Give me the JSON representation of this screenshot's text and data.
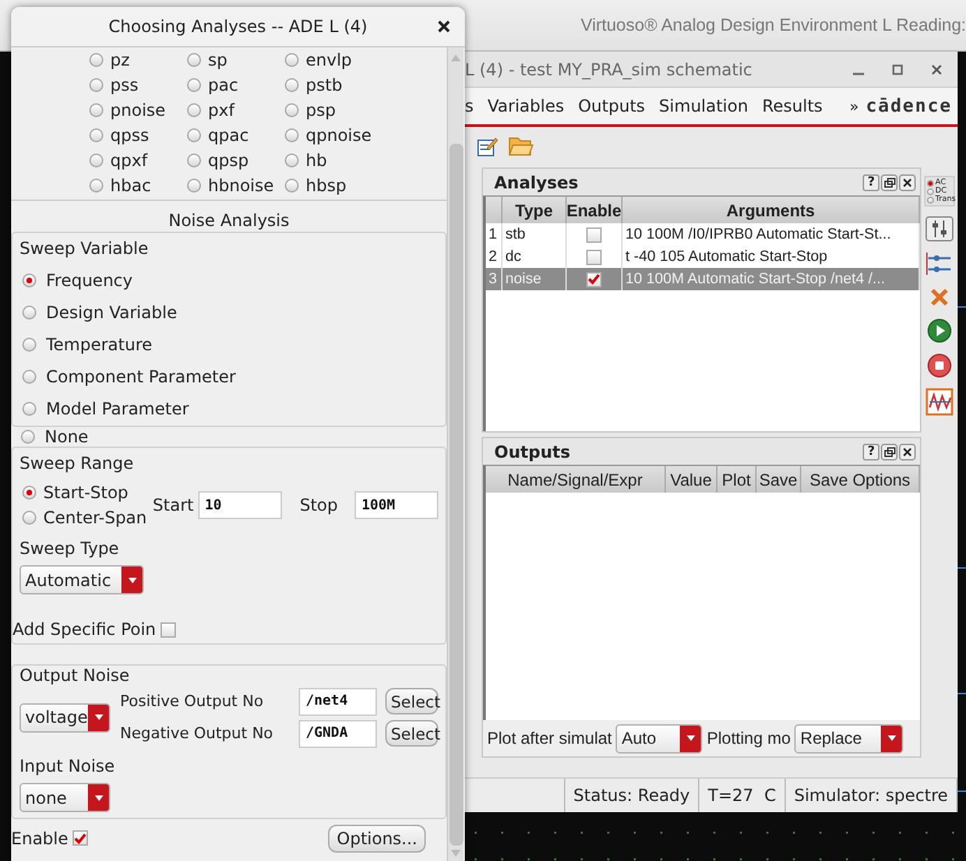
{
  "background_window": {
    "title": "Virtuoso® Analog Design Environment L Reading:"
  },
  "main_window": {
    "title": "L (4) - test MY_PRA_sim schematic",
    "menu": [
      "s",
      "Variables",
      "Outputs",
      "Simulation",
      "Results"
    ],
    "menu_overflow": "»",
    "logo": "cādence",
    "analyses": {
      "title": "Analyses",
      "help": "?",
      "columns": [
        "Type",
        "Enable",
        "Arguments"
      ],
      "rows": [
        {
          "number": "1",
          "type": "stb",
          "enabled": false,
          "arguments": "10 100M /I0/IPRB0 Automatic Start-St...",
          "selected": false
        },
        {
          "number": "2",
          "type": "dc",
          "enabled": false,
          "arguments": "t -40 105 Automatic Start-Stop",
          "selected": false
        },
        {
          "number": "3",
          "type": "noise",
          "enabled": true,
          "arguments": "10 100M Automatic Start-Stop /net4 /...",
          "selected": true
        }
      ]
    },
    "tool_palette": {
      "modes": [
        {
          "label": "AC",
          "selected": true
        },
        {
          "label": "DC",
          "selected": false
        },
        {
          "label": "Trans",
          "selected": false
        }
      ]
    },
    "outputs": {
      "title": "Outputs",
      "help": "?",
      "columns": [
        "Name/Signal/Expr",
        "Value",
        "Plot",
        "Save",
        "Save Options"
      ],
      "plot_after_label": "Plot after simulat",
      "plot_after_value": "Auto",
      "plotting_mode_label": "Plotting mo",
      "plotting_mode_value": "Replace"
    },
    "status_bar": [
      "Status: Ready",
      "T=27  C",
      "Simulator: spectre"
    ]
  },
  "dialog": {
    "title": "Choosing Analyses -- ADE L (4)",
    "analysis_types": [
      {
        "label": "pz",
        "selected": false
      },
      {
        "label": "sp",
        "selected": false
      },
      {
        "label": "envlp",
        "selected": false
      },
      {
        "label": "pss",
        "selected": false
      },
      {
        "label": "pac",
        "selected": false
      },
      {
        "label": "pstb",
        "selected": false
      },
      {
        "label": "pnoise",
        "selected": false
      },
      {
        "label": "pxf",
        "selected": false
      },
      {
        "label": "psp",
        "selected": false
      },
      {
        "label": "qpss",
        "selected": false
      },
      {
        "label": "qpac",
        "selected": false
      },
      {
        "label": "qpnoise",
        "selected": false
      },
      {
        "label": "qpxf",
        "selected": false
      },
      {
        "label": "qpsp",
        "selected": false
      },
      {
        "label": "hb",
        "selected": false
      },
      {
        "label": "hbac",
        "selected": false
      },
      {
        "label": "hbnoise",
        "selected": false
      },
      {
        "label": "hbsp",
        "selected": false
      }
    ],
    "section_title": "Noise Analysis",
    "sweep_variable": {
      "label": "Sweep Variable",
      "options": [
        {
          "label": "Frequency",
          "selected": true
        },
        {
          "label": "Design Variable",
          "selected": false
        },
        {
          "label": "Temperature",
          "selected": false
        },
        {
          "label": "Component Parameter",
          "selected": false
        },
        {
          "label": "Model Parameter",
          "selected": false
        },
        {
          "label": "None",
          "selected": false
        }
      ]
    },
    "sweep_range": {
      "label": "Sweep Range",
      "options": [
        {
          "label": "Start-Stop",
          "selected": true
        },
        {
          "label": "Center-Span",
          "selected": false
        }
      ],
      "start_label": "Start",
      "start_value": "10",
      "stop_label": "Stop",
      "stop_value": "100M"
    },
    "sweep_type": {
      "label": "Sweep Type",
      "value": "Automatic"
    },
    "add_specific_points": {
      "label": "Add Specific Poin",
      "checked": false
    },
    "output_noise": {
      "label": "Output Noise",
      "value": "voltage",
      "positive_label": "Positive Output No",
      "positive_value": "/net4",
      "positive_select": "Select",
      "negative_label": "Negative Output No",
      "negative_value": "/GNDA",
      "negative_select": "Select"
    },
    "input_noise": {
      "label": "Input Noise",
      "value": "none"
    },
    "enabled": {
      "label": "Enable",
      "checked": true
    },
    "options_button": "Options..."
  }
}
